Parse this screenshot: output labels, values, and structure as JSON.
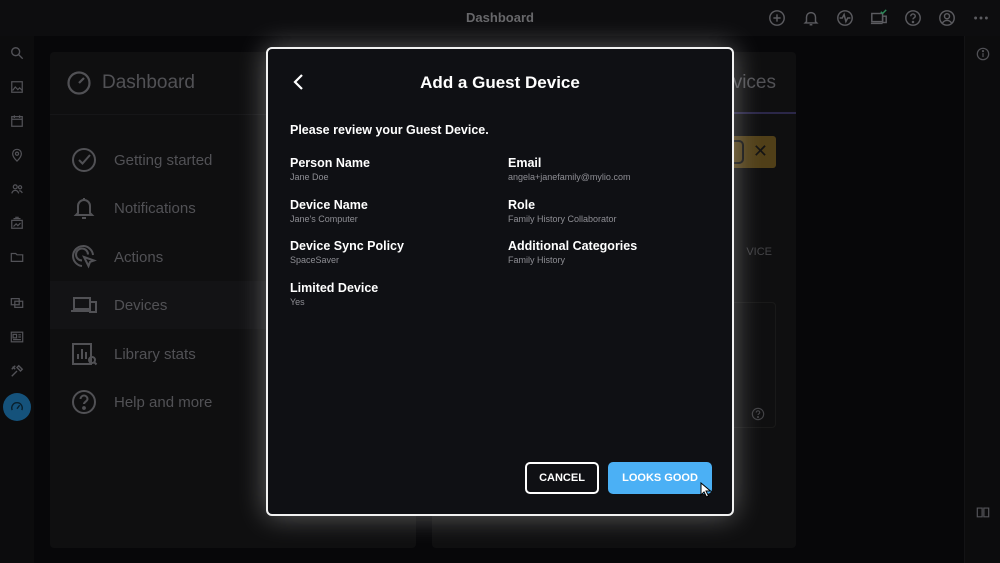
{
  "topbar": {
    "title": "Dashboard"
  },
  "left_panel": {
    "title": "Dashboard",
    "items": [
      {
        "label": "Getting started",
        "icon": "check-circle-icon"
      },
      {
        "label": "Notifications",
        "icon": "bell-icon"
      },
      {
        "label": "Actions",
        "icon": "cursor-click-icon"
      },
      {
        "label": "Devices",
        "icon": "devices-icon",
        "selected": true
      },
      {
        "label": "Library stats",
        "icon": "stats-icon"
      },
      {
        "label": "Help and more",
        "icon": "help-icon"
      }
    ]
  },
  "right_panel": {
    "title_fragment": "vices",
    "button_fragment": "VICE"
  },
  "modal": {
    "title": "Add a Guest Device",
    "intro": "Please review your Guest Device.",
    "fields": [
      {
        "label": "Person Name",
        "value": "Jane Doe"
      },
      {
        "label": "Email",
        "value": "angela+janefamily@mylio.com"
      },
      {
        "label": "Device Name",
        "value": "Jane's Computer"
      },
      {
        "label": "Role",
        "value": "Family History Collaborator"
      },
      {
        "label": "Device Sync Policy",
        "value": "SpaceSaver"
      },
      {
        "label": "Additional Categories",
        "value": "Family History"
      },
      {
        "label": "Limited Device",
        "value": "Yes"
      }
    ],
    "cancel_label": "CANCEL",
    "ok_label": "LOOKS GOOD"
  },
  "colors": {
    "accent": "#4bb0f5",
    "rail_active": "#1c6ea4",
    "banner": "#6b5420"
  }
}
